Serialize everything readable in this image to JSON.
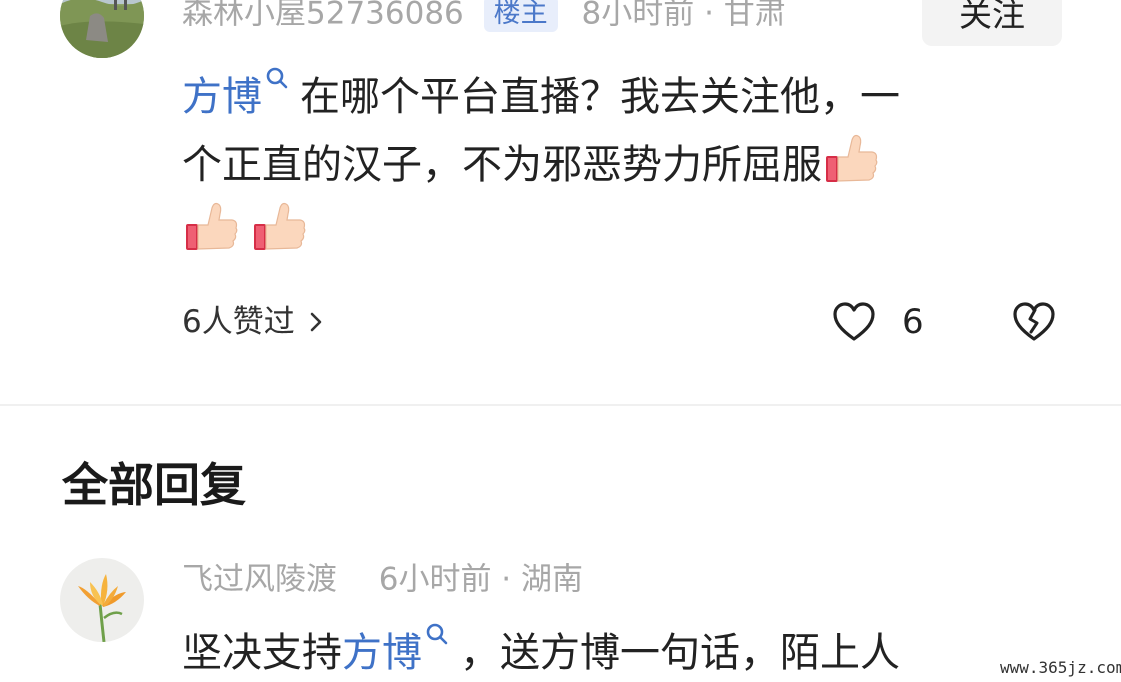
{
  "op_comment": {
    "username": "森林小屋52736086",
    "badge": "楼主",
    "time_location": "8小时前 · 甘肃",
    "follow_label": "关注",
    "mention": "方博",
    "text_line1": "在哪个平台直播？我去关注他，一",
    "text_line2": "个正直的汉子，不为邪恶势力所屈服",
    "likes_by": "6人赞过",
    "like_count": "6",
    "thumb_count": 3
  },
  "section": {
    "title": "全部回复"
  },
  "reply": {
    "username": "飞过风陵渡",
    "time_location": "6小时前 · 湖南",
    "text_prefix": "坚决支持",
    "mention": "方博",
    "text_suffix": "，送方博一句话，陌上人"
  },
  "watermark": "www.365jz.com",
  "icons": {
    "like": "heart-outline-icon",
    "dislike": "broken-heart-icon",
    "mention": "search-icon",
    "chevron": "chevron-right-icon",
    "thumb": "thumbs-up-emoji"
  },
  "colors": {
    "link": "#3f72c7",
    "meta": "#a7a7a7",
    "badge_bg": "#e8eefb",
    "badge_fg": "#4b78c9"
  }
}
